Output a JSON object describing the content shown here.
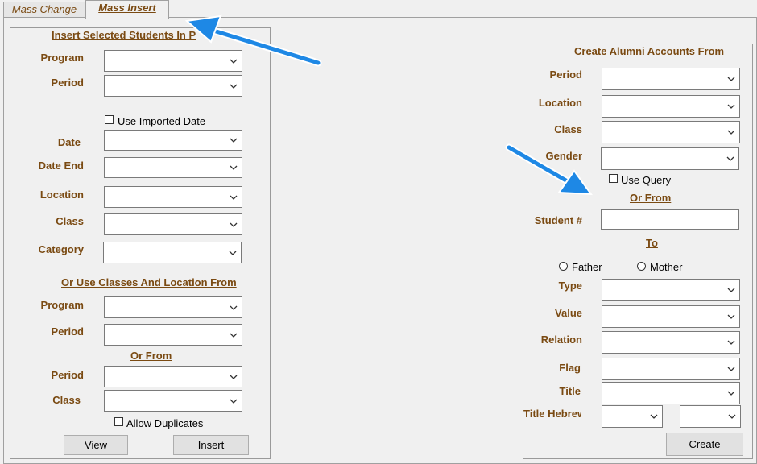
{
  "tabs": {
    "mass_change": "Mass Change",
    "mass_insert": "Mass Insert"
  },
  "left": {
    "title": "Insert Selected Students In P",
    "program": "Program",
    "period": "Period",
    "use_imported_date": "Use Imported Date",
    "date": "Date",
    "date_end": "Date End",
    "location": "Location",
    "class": "Class",
    "category": "Category",
    "section_title": "Or Use Classes And Location From",
    "program2": "Program",
    "period2": "Period",
    "or_from": "Or From",
    "period3": "Period",
    "class2": "Class",
    "allow_duplicates": "Allow Duplicates",
    "view_button": "View",
    "insert_button": "Insert"
  },
  "right": {
    "title": "Create Alumni Accounts From",
    "period": "Period",
    "location": "Location",
    "class": "Class",
    "gender": "Gender",
    "use_query": "Use Query",
    "or_from": "Or From",
    "student_num": "Student #",
    "to": "To",
    "father": "Father",
    "mother": "Mother",
    "type": "Type",
    "value": "Value",
    "relation": "Relation",
    "flag": "Flag",
    "title_label": "Title",
    "title_hebrew": "Title Hebrew",
    "create_button": "Create"
  },
  "colors": {
    "label": "#7a4a12",
    "arrow": "#1e88e5"
  }
}
